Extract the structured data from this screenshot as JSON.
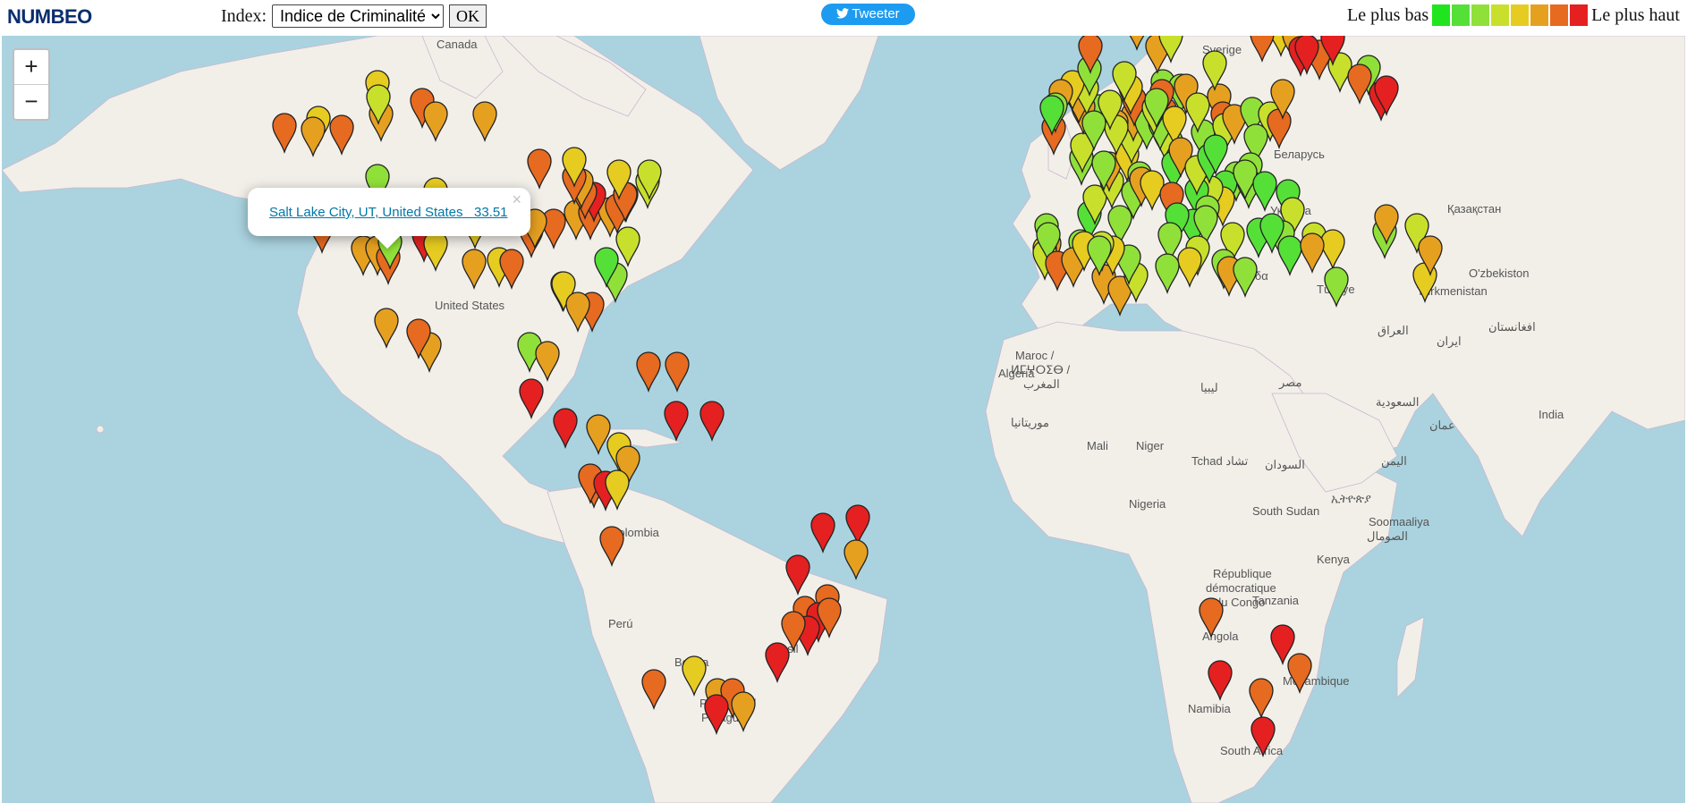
{
  "header": {
    "logo": "NUMBEO",
    "index_label": "Index:",
    "index_selected": "Indice de Criminalité",
    "ok_label": "OK",
    "tweet_label": "Tweeter",
    "legend_low": "Le plus bas",
    "legend_high": "Le plus haut",
    "legend_colors": [
      "#1fe51f",
      "#55e038",
      "#90e03a",
      "#c8e02c",
      "#e6cc20",
      "#e6a020",
      "#e66a20",
      "#e52020"
    ]
  },
  "map": {
    "zoom_in": "+",
    "zoom_out": "−",
    "popup": {
      "link_text": "Salt Lake City, UT, United States   33.51",
      "close": "×"
    },
    "labels": [
      {
        "text": "Canada"
      },
      {
        "text": "United States"
      },
      {
        "text": "Colombia"
      },
      {
        "text": "Bolivia"
      },
      {
        "text": "Paraguay /"
      },
      {
        "text": "Paraguái"
      },
      {
        "text": "Brasil"
      },
      {
        "text": "Perú"
      },
      {
        "text": "Maroc /"
      },
      {
        "text": "ⵍⵎⵖⵔⵉⴱ /"
      },
      {
        "text": "المغرب"
      },
      {
        "text": "Algeria"
      },
      {
        "text": "ليبيا"
      },
      {
        "text": "مصر"
      },
      {
        "text": "موريتانيا"
      },
      {
        "text": "Mali"
      },
      {
        "text": "Niger"
      },
      {
        "text": "Tchad تشاد"
      },
      {
        "text": "السودان"
      },
      {
        "text": "Nigeria"
      },
      {
        "text": "South Sudan"
      },
      {
        "text": "ኢትዮጵያ"
      },
      {
        "text": "Soomaaliya"
      },
      {
        "text": "الصومال"
      },
      {
        "text": "Kenya"
      },
      {
        "text": "République"
      },
      {
        "text": "démocratique"
      },
      {
        "text": "du Congo"
      },
      {
        "text": "Tanzania"
      },
      {
        "text": "Angola"
      },
      {
        "text": "Namibia"
      },
      {
        "text": "Moçambique"
      },
      {
        "text": "South Africa"
      },
      {
        "text": "Türkiye"
      },
      {
        "text": "العراق"
      },
      {
        "text": "ایران"
      },
      {
        "text": "السعودية"
      },
      {
        "text": "عمان"
      },
      {
        "text": "اليمن"
      },
      {
        "text": "Қазақстан"
      },
      {
        "text": "O'zbekiston"
      },
      {
        "text": "Türkmenistan"
      },
      {
        "text": "افغانستان"
      },
      {
        "text": "Sverige"
      },
      {
        "text": "Беларусь"
      },
      {
        "text": "Україна"
      },
      {
        "text": "Ελλάδα"
      },
      {
        "text": "India"
      }
    ],
    "markers": [
      {
        "c": 4
      },
      {
        "c": 4
      },
      {
        "c": 6
      },
      {
        "c": 5
      },
      {
        "c": 3
      },
      {
        "c": 6
      },
      {
        "c": 5
      },
      {
        "c": 5
      },
      {
        "c": 6
      },
      {
        "c": 5
      },
      {
        "c": 2
      },
      {
        "c": 4
      },
      {
        "c": 6
      },
      {
        "c": 5
      },
      {
        "c": 6
      },
      {
        "c": 7
      },
      {
        "c": 5
      },
      {
        "c": 6
      },
      {
        "c": 5
      },
      {
        "c": 4
      },
      {
        "c": 6
      },
      {
        "c": 6
      },
      {
        "c": 5
      },
      {
        "c": 6
      },
      {
        "c": 5
      },
      {
        "c": 7
      },
      {
        "c": 6
      },
      {
        "c": 5
      },
      {
        "c": 6
      },
      {
        "c": 4
      },
      {
        "c": 5
      },
      {
        "c": 6
      },
      {
        "c": 4
      },
      {
        "c": 4
      },
      {
        "c": 6
      },
      {
        "c": 5
      },
      {
        "c": 2
      },
      {
        "c": 1
      },
      {
        "c": 3
      },
      {
        "c": 6
      },
      {
        "c": 3
      },
      {
        "c": 4
      },
      {
        "c": 6
      },
      {
        "c": 5
      },
      {
        "c": 3
      },
      {
        "c": 4
      },
      {
        "c": 4
      },
      {
        "c": 5
      },
      {
        "c": 5
      },
      {
        "c": 6
      },
      {
        "c": 2
      },
      {
        "c": 5
      },
      {
        "c": 7
      },
      {
        "c": 6
      },
      {
        "c": 6
      },
      {
        "c": 7
      },
      {
        "c": 7
      },
      {
        "c": 7
      },
      {
        "c": 5
      },
      {
        "c": 4
      },
      {
        "c": 5
      },
      {
        "c": 6
      },
      {
        "c": 6
      },
      {
        "c": 7
      },
      {
        "c": 4
      },
      {
        "c": 6
      },
      {
        "c": 7
      },
      {
        "c": 7
      },
      {
        "c": 7
      },
      {
        "c": 5
      },
      {
        "c": 6
      },
      {
        "c": 6
      },
      {
        "c": 7
      },
      {
        "c": 7
      },
      {
        "c": 6
      },
      {
        "c": 7
      },
      {
        "c": 6
      },
      {
        "c": 4
      },
      {
        "c": 6
      },
      {
        "c": 5
      },
      {
        "c": 6
      },
      {
        "c": 5
      },
      {
        "c": 7
      },
      {
        "c": 6
      },
      {
        "c": 7
      },
      {
        "c": 7
      },
      {
        "c": 6
      },
      {
        "c": 6
      },
      {
        "c": 7
      },
      {
        "c": 5
      },
      {
        "c": 5
      },
      {
        "c": 4
      },
      {
        "c": 3
      },
      {
        "c": 2
      },
      {
        "c": 1
      },
      {
        "c": 2
      },
      {
        "c": 3
      },
      {
        "c": 3
      },
      {
        "c": 2
      },
      {
        "c": 5
      },
      {
        "c": 2
      },
      {
        "c": 3
      },
      {
        "c": 2
      },
      {
        "c": 4
      },
      {
        "c": 3
      },
      {
        "c": 5
      },
      {
        "c": 2
      },
      {
        "c": 6
      },
      {
        "c": 5
      },
      {
        "c": 3
      },
      {
        "c": 4
      },
      {
        "c": 2
      },
      {
        "c": 3
      },
      {
        "c": 2
      },
      {
        "c": 5
      },
      {
        "c": 5
      },
      {
        "c": 3
      },
      {
        "c": 4
      },
      {
        "c": 5
      },
      {
        "c": 6
      },
      {
        "c": 2
      },
      {
        "c": 1
      },
      {
        "c": 2
      },
      {
        "c": 3
      },
      {
        "c": 2
      },
      {
        "c": 6
      },
      {
        "c": 5
      },
      {
        "c": 5
      },
      {
        "c": 3
      },
      {
        "c": 2
      },
      {
        "c": 6
      },
      {
        "c": 2
      },
      {
        "c": 3
      },
      {
        "c": 2
      },
      {
        "c": 3
      },
      {
        "c": 4
      },
      {
        "c": 5
      },
      {
        "c": 6
      },
      {
        "c": 2
      },
      {
        "c": 1
      },
      {
        "c": 2
      },
      {
        "c": 5
      },
      {
        "c": 4
      },
      {
        "c": 6
      },
      {
        "c": 5
      },
      {
        "c": 2
      },
      {
        "c": 3
      },
      {
        "c": 5
      },
      {
        "c": 6
      },
      {
        "c": 3
      },
      {
        "c": 5
      },
      {
        "c": 2
      },
      {
        "c": 3
      },
      {
        "c": 6
      },
      {
        "c": 5
      },
      {
        "c": 2
      },
      {
        "c": 2
      },
      {
        "c": 2
      },
      {
        "c": 2
      },
      {
        "c": 1
      },
      {
        "c": 4
      },
      {
        "c": 3
      },
      {
        "c": 1
      },
      {
        "c": 2
      },
      {
        "c": 1
      },
      {
        "c": 1
      },
      {
        "c": 2
      },
      {
        "c": 2
      },
      {
        "c": 3
      },
      {
        "c": 2
      },
      {
        "c": 3
      },
      {
        "c": 4
      },
      {
        "c": 2
      },
      {
        "c": 5
      },
      {
        "c": 3
      },
      {
        "c": 2
      },
      {
        "c": 4
      },
      {
        "c": 3
      },
      {
        "c": 2
      },
      {
        "c": 2
      },
      {
        "c": 6
      },
      {
        "c": 5
      },
      {
        "c": 4
      },
      {
        "c": 2
      },
      {
        "c": 3
      },
      {
        "c": 1
      },
      {
        "c": 1
      },
      {
        "c": 2
      },
      {
        "c": 1
      },
      {
        "c": 1
      },
      {
        "c": 3
      },
      {
        "c": 2
      },
      {
        "c": 1
      },
      {
        "c": 1
      },
      {
        "c": 1
      },
      {
        "c": 5
      },
      {
        "c": 2
      },
      {
        "c": 3
      },
      {
        "c": 4
      },
      {
        "c": 5
      },
      {
        "c": 2
      },
      {
        "c": 2
      },
      {
        "c": 5
      },
      {
        "c": 3
      },
      {
        "c": 4
      },
      {
        "c": 5
      },
      {
        "c": 3
      },
      {
        "c": 2
      },
      {
        "c": 2
      },
      {
        "c": 3
      },
      {
        "c": 4
      },
      {
        "c": 6
      },
      {
        "c": 5
      },
      {
        "c": 6
      },
      {
        "c": 6
      },
      {
        "c": 7
      },
      {
        "c": 7
      },
      {
        "c": 7
      },
      {
        "c": 7
      },
      {
        "c": 7
      }
    ]
  }
}
